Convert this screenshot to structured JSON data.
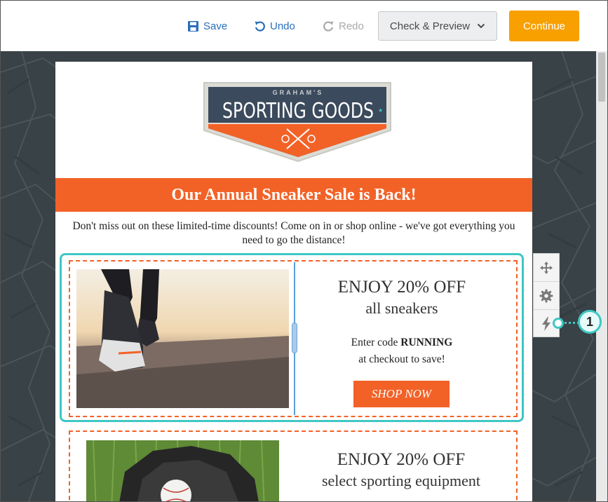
{
  "toolbar": {
    "save_label": "Save",
    "undo_label": "Undo",
    "redo_label": "Redo",
    "check_preview_label": "Check & Preview",
    "continue_label": "Continue"
  },
  "email": {
    "logo": {
      "top_text": "GRAHAM'S",
      "main_text": "SPORTING GOODS"
    },
    "banner_title": "Our Annual Sneaker Sale is Back!",
    "intro_text": "Don't miss out on these limited-time discounts! Come on in or shop online - we've got everything you need to go the distance!",
    "promo1": {
      "title": "ENJOY 20% OFF",
      "subtitle": "all sneakers",
      "code_line1_prefix": "Enter code ",
      "code": "RUNNING",
      "code_line2": "at checkout to save!",
      "button_label": "SHOP NOW"
    },
    "promo2": {
      "title": "ENJOY 20% OFF",
      "subtitle": "select sporting equipment"
    }
  },
  "side_tools": [
    "move-icon",
    "gear-icon",
    "lightning-icon"
  ],
  "callout": {
    "number": "1"
  },
  "colors": {
    "brand_orange": "#f26227",
    "continue_orange": "#f7a000",
    "link_blue": "#2a6ebb",
    "selection_teal": "#3ec7c4",
    "logo_navy": "#3b4a5c"
  }
}
